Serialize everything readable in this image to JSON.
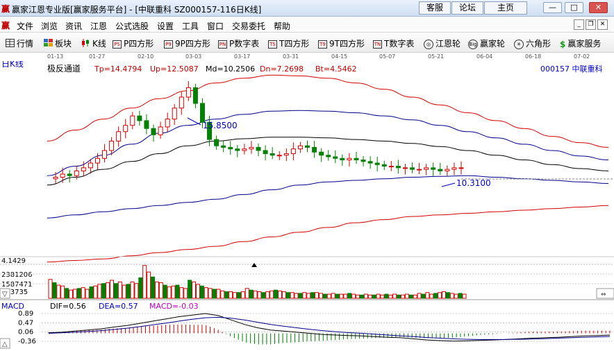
{
  "window": {
    "logo": "赢",
    "title": "赢家江恩专业版[赢家服务平台] - [中联重科  SZ000157-116日K线]",
    "buttons": [
      "客服",
      "论坛",
      "主页"
    ]
  },
  "menu": {
    "logo": "赢",
    "items": [
      "文件",
      "浏览",
      "资讯",
      "江恩",
      "公式选股",
      "设置",
      "工具",
      "窗口",
      "交易委托",
      "帮助"
    ]
  },
  "toolbar": {
    "items": [
      {
        "label": "行情",
        "icon": "grid-icon"
      },
      {
        "label": "板块",
        "icon": "blocks-icon"
      },
      {
        "label": "K线",
        "icon": "kline-icon"
      },
      {
        "label": "P四方形",
        "icon": "ps-icon",
        "tag": "PS"
      },
      {
        "label": "9P四方形",
        "icon": "p9-icon",
        "tag": "P9"
      },
      {
        "label": "P数字表",
        "icon": "pn-icon",
        "tag": "PN"
      },
      {
        "label": "T四方形",
        "icon": "ts-icon",
        "tag": "TS"
      },
      {
        "label": "9T四方形",
        "icon": "t9-icon",
        "tag": "T9"
      },
      {
        "label": "T数字表",
        "icon": "tn-icon",
        "tag": "TN"
      },
      {
        "label": "江恩轮",
        "icon": "gann-wheel-icon"
      },
      {
        "label": "赢家轮",
        "icon": "winner-wheel-icon",
        "tag": "Big"
      },
      {
        "label": "六角形",
        "icon": "hexagon-icon"
      },
      {
        "label": "赢家服务",
        "icon": "dollar-icon",
        "tag": "$"
      }
    ]
  },
  "dates": [
    "01-13",
    "01-27",
    "02-10",
    "03-03",
    "03-17",
    "03-31",
    "04-15",
    "05-07",
    "05-21",
    "06-04",
    "06-18",
    "07-02"
  ],
  "chart": {
    "panel_label": "日K线",
    "indicator": "极反通道",
    "tp": "Tp=14.4794",
    "up": "Up=12.5087",
    "md": "Md=10.2506",
    "dn": "Dn=7.2698",
    "bt": "Bt=4.5462",
    "stock": "000157 中联重科",
    "high_label": "15.8500",
    "low_label": "10.3100"
  },
  "volume": {
    "axis_labels": [
      "4.1429",
      "2381206",
      "1587471",
      "793735"
    ]
  },
  "macd": {
    "label": "MACD",
    "dif": "DIF=0.56",
    "dea": "DEA=0.57",
    "macd": "MACD=-0.03",
    "axis_labels": [
      "0.89",
      "0.47",
      "0.06",
      "-0.36"
    ]
  },
  "colors": {
    "up": "#d40000",
    "down": "#008000",
    "red_band": "#d40000",
    "blue_band": "#00008b",
    "mid_line": "#000000",
    "label_red": "#c00000",
    "label_blue": "#0000c8",
    "label_magenta": "#c000c0"
  },
  "chart_data": [
    {
      "type": "line",
      "title": "极反通道",
      "series": [
        {
          "name": "Tp",
          "values": [
            12.2,
            12.9,
            13.6,
            14.3,
            14.9,
            15.4,
            15.9,
            16.2,
            16.4,
            16.35,
            16.2,
            15.9,
            15.5,
            15.0,
            14.5,
            14.0,
            13.5,
            13.0,
            12.5,
            12.1,
            11.8
          ]
        },
        {
          "name": "Up",
          "values": [
            10.0,
            10.6,
            11.3,
            12.0,
            12.7,
            13.2,
            13.6,
            13.9,
            14.1,
            14.15,
            14.1,
            14.0,
            13.8,
            13.55,
            13.2,
            12.8,
            12.4,
            12.0,
            11.6,
            11.25,
            11.0
          ]
        },
        {
          "name": "Md",
          "values": [
            9.4,
            9.9,
            10.4,
            10.9,
            11.4,
            11.9,
            12.2,
            12.35,
            12.45,
            12.45,
            12.4,
            12.3,
            12.2,
            12.05,
            11.85,
            11.6,
            11.3,
            11.0,
            10.7,
            10.45,
            10.3
          ]
        },
        {
          "name": "Dn",
          "values": [
            7.3,
            7.5,
            7.7,
            7.9,
            8.1,
            8.3,
            8.5,
            8.8,
            9.1,
            9.4,
            9.6,
            9.7,
            9.8,
            9.9,
            9.95,
            10.0,
            9.9,
            9.8,
            9.7,
            9.6,
            9.5
          ]
        },
        {
          "name": "Bt",
          "values": [
            4.5,
            4.6,
            4.7,
            4.9,
            5.1,
            5.3,
            5.5,
            5.8,
            6.1,
            6.4,
            6.7,
            7.0,
            7.2,
            7.4,
            7.5,
            7.6,
            7.7,
            7.8,
            7.9,
            8.0,
            8.1
          ]
        }
      ]
    },
    {
      "type": "bar",
      "title": "成交量",
      "values": [
        2.3,
        1.9,
        1.6,
        1.5,
        1.2,
        1.0,
        1.1,
        1.2,
        1.3,
        1.1,
        1.4,
        1.5,
        1.7,
        1.8,
        1.9,
        2.2,
        1.8,
        2.0,
        1.6,
        1.7,
        2.0,
        1.8,
        2.5,
        4.0,
        3.2,
        2.6,
        2.0,
        1.9,
        1.6,
        1.4,
        1.5,
        1.6,
        1.3,
        1.2,
        2.2,
        2.0,
        1.7,
        1.5,
        1.3,
        1.2,
        1.1,
        1.1,
        0.9,
        0.8,
        0.8,
        0.7,
        0.7,
        0.8,
        1.2,
        1.0,
        0.9,
        0.8,
        0.7,
        0.8,
        0.9,
        1.0,
        0.9,
        0.8,
        0.7,
        0.7,
        0.6,
        0.6,
        0.7,
        0.6,
        0.7,
        0.7,
        0.6,
        0.5,
        0.5,
        0.6,
        0.5,
        0.5,
        0.5,
        0.6,
        0.5,
        0.4,
        0.4,
        0.5,
        0.4,
        0.4,
        0.5,
        0.4,
        0.5,
        0.4,
        0.5,
        0.4,
        0.4,
        0.5,
        0.4,
        0.4,
        0.6,
        0.5,
        0.7,
        0.5,
        0.6,
        0.7,
        0.8,
        0.7,
        0.6,
        0.5,
        0.6,
        0.5
      ],
      "ylim": [
        0,
        4.1429
      ]
    },
    {
      "type": "line",
      "title": "MACD",
      "series": [
        {
          "name": "DIF",
          "values": [
            0.02,
            0.05,
            0.1,
            0.15,
            0.2,
            0.28,
            0.35,
            0.45,
            0.55,
            0.65,
            0.75,
            0.82,
            0.89,
            0.8,
            0.6,
            0.4,
            0.25,
            0.15,
            0.1,
            0.05,
            0.0,
            -0.05,
            -0.08,
            -0.1,
            -0.12,
            -0.15,
            -0.18,
            -0.2,
            -0.25,
            -0.3,
            -0.33,
            -0.35,
            -0.34,
            -0.32,
            -0.3,
            -0.28,
            -0.25,
            -0.22,
            -0.2,
            -0.18,
            -0.15,
            -0.12,
            -0.1,
            -0.08
          ]
        },
        {
          "name": "DEA",
          "values": [
            0.0,
            0.02,
            0.05,
            0.08,
            0.12,
            0.17,
            0.23,
            0.3,
            0.38,
            0.46,
            0.55,
            0.63,
            0.7,
            0.72,
            0.68,
            0.6,
            0.5,
            0.4,
            0.32,
            0.25,
            0.18,
            0.12,
            0.07,
            0.03,
            0.0,
            -0.04,
            -0.08,
            -0.12,
            -0.15,
            -0.19,
            -0.22,
            -0.25,
            -0.27,
            -0.28,
            -0.28,
            -0.28,
            -0.27,
            -0.26,
            -0.24,
            -0.22,
            -0.2,
            -0.18,
            -0.16,
            -0.14
          ]
        }
      ],
      "ylim": [
        -0.36,
        0.89
      ]
    }
  ]
}
